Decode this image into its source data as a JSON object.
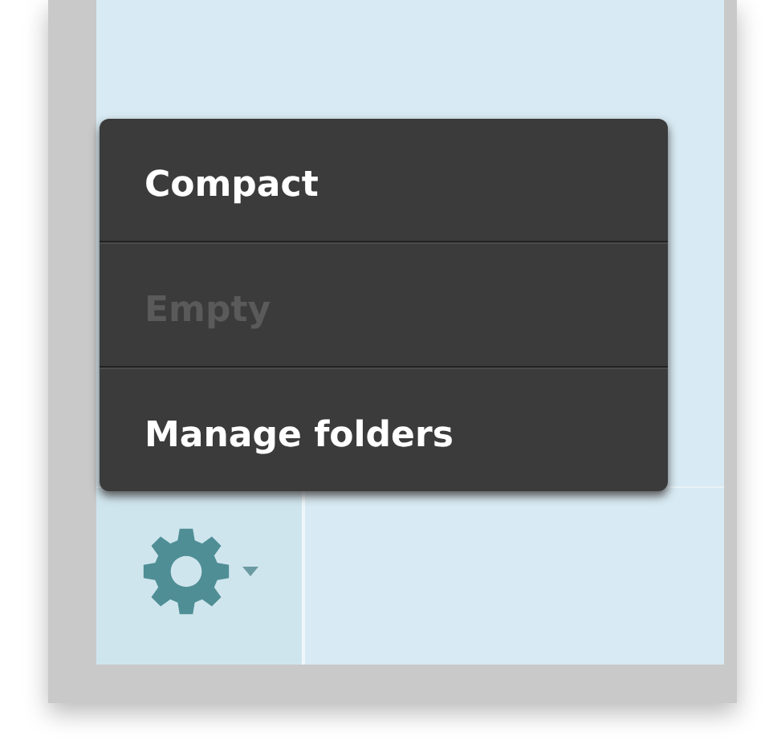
{
  "menu": {
    "items": [
      {
        "label": "Compact",
        "disabled": false
      },
      {
        "label": "Empty",
        "disabled": true
      },
      {
        "label": "Manage folders",
        "disabled": false
      }
    ]
  }
}
